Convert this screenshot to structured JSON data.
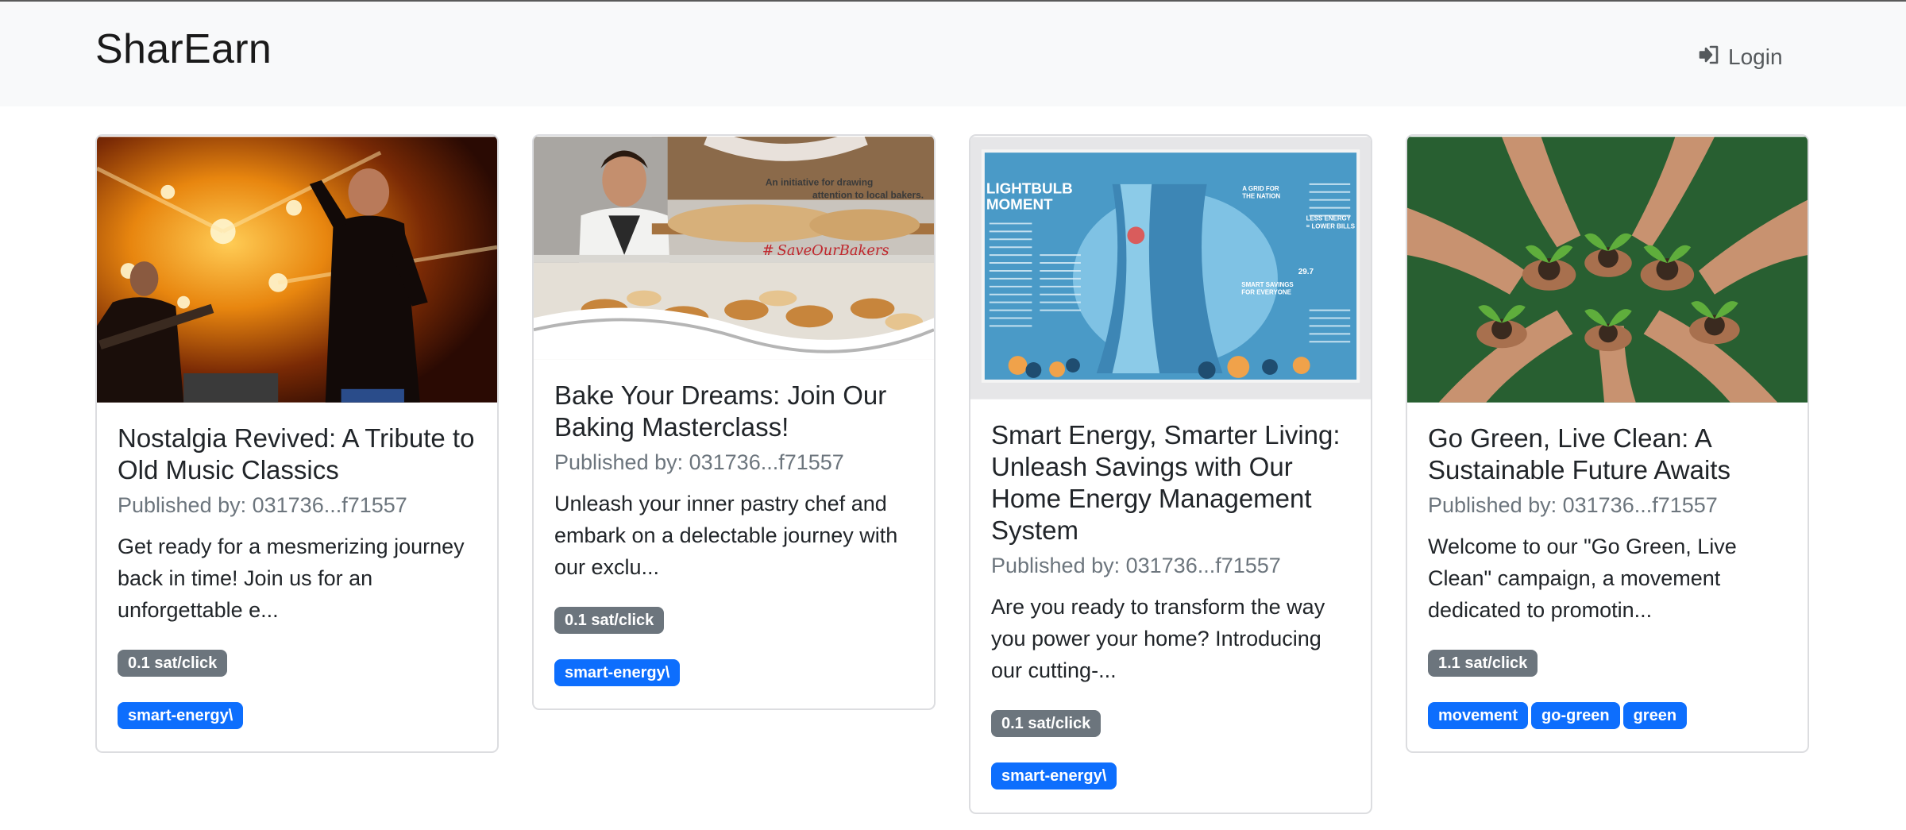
{
  "navbar": {
    "brand": "SharEarn",
    "login_label": "Login",
    "login_icon": "sign-in-icon"
  },
  "colors": {
    "navbar_bg": "#f8f9fa",
    "rate_badge": "#6c757d",
    "tag_badge": "#0d6efd"
  },
  "cards": [
    {
      "title": "Nostalgia Revived: A Tribute to Old Music Classics",
      "publisher": "Published by: 031736...f71557",
      "description": "Get ready for a mesmerizing journey back in time! Join us for an unforgettable e...",
      "rate": "0.1 sat/click",
      "tags": [
        "smart-energy\\"
      ],
      "image": "concert-singer-photo"
    },
    {
      "title": "Bake Your Dreams: Join Our Baking Masterclass!",
      "publisher": "Published by: 031736...f71557",
      "description": "Unleash your inner pastry chef and embark on a delectable journey with our exclu...",
      "rate": "0.1 sat/click",
      "tags": [
        "smart-energy\\"
      ],
      "image": "baker-pastries-banner",
      "image_text": {
        "tagline": "An initiative for drawing attention to local bakers.",
        "hashtag": "# SaveOurBakers"
      }
    },
    {
      "title": "Smart Energy, Smarter Living: Unleash Savings with Our Home Energy Management System",
      "publisher": "Published by: 031736...f71557",
      "description": "Are you ready to transform the way you power your home? Introducing our cutting-...",
      "rate": "0.1 sat/click",
      "tags": [
        "smart-energy\\"
      ],
      "image": "magazine-cooling-tower-spread",
      "image_text": {
        "headline": "LIGHTBULB MOMENT",
        "callout_1": "A GRID FOR THE NATION",
        "callout_2": "LESS ENERGY = LOWER BILLS",
        "callout_3": "SMART SAVINGS FOR EVERYONE",
        "stat": "29.7"
      }
    },
    {
      "title": "Go Green, Live Clean: A Sustainable Future Awaits",
      "publisher": "Published by: 031736...f71557",
      "description": "Welcome to our \"Go Green, Live Clean\" campaign, a movement dedicated to promotin...",
      "rate": "1.1 sat/click",
      "tags": [
        "movement",
        "go-green",
        "green"
      ],
      "image": "hands-holding-seedlings-photo"
    }
  ]
}
